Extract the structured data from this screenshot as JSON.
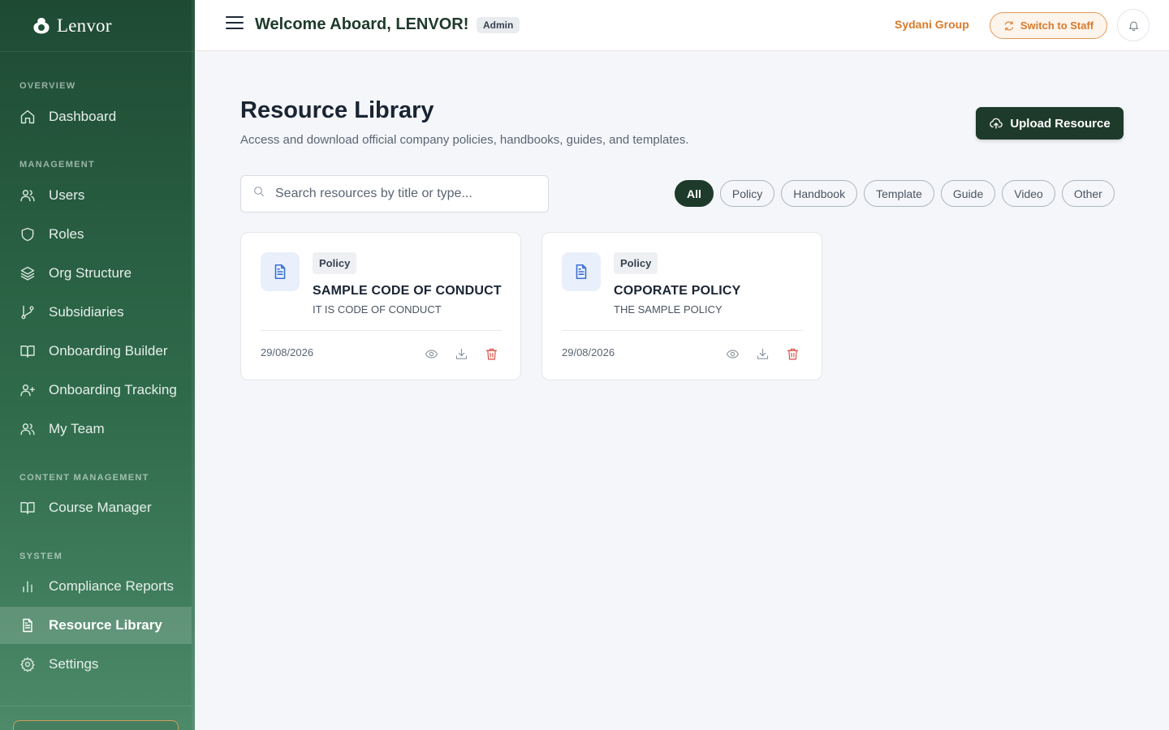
{
  "brand": {
    "name": "Lenvor"
  },
  "sidebar": {
    "sections": [
      {
        "label": "OVERVIEW"
      },
      {
        "label": "MANAGEMENT"
      },
      {
        "label": "CONTENT MANAGEMENT"
      },
      {
        "label": "SYSTEM"
      }
    ],
    "items": [
      {
        "label": "Dashboard",
        "icon": "home-icon"
      },
      {
        "label": "Users",
        "icon": "users-icon"
      },
      {
        "label": "Roles",
        "icon": "shield-icon"
      },
      {
        "label": "Org Structure",
        "icon": "layers-icon"
      },
      {
        "label": "Subsidiaries",
        "icon": "git-branch-icon"
      },
      {
        "label": "Onboarding Builder",
        "icon": "book-icon"
      },
      {
        "label": "Onboarding Tracking",
        "icon": "user-plus-icon"
      },
      {
        "label": "My Team",
        "icon": "users-icon"
      },
      {
        "label": "Course Manager",
        "icon": "book-icon"
      },
      {
        "label": "Compliance Reports",
        "icon": "bar-chart-icon"
      },
      {
        "label": "Resource Library",
        "icon": "file-text-icon",
        "active": true
      },
      {
        "label": "Settings",
        "icon": "gear-icon"
      }
    ]
  },
  "header": {
    "welcome": "Welcome Aboard, LENVOR!",
    "role_badge": "Admin",
    "org_name": "Sydani Group",
    "switch_label": "Switch to Staff"
  },
  "main": {
    "title": "Resource Library",
    "subtitle": "Access and download official company policies, handbooks, guides, and templates.",
    "upload_label": "Upload Resource",
    "search": {
      "placeholder": "Search resources by title or type...",
      "value": ""
    },
    "filters": [
      {
        "label": "All",
        "active": true
      },
      {
        "label": "Policy"
      },
      {
        "label": "Handbook"
      },
      {
        "label": "Template"
      },
      {
        "label": "Guide"
      },
      {
        "label": "Video"
      },
      {
        "label": "Other"
      }
    ],
    "cards": [
      {
        "tag": "Policy",
        "title": "SAMPLE CODE OF CONDUCT",
        "description": "IT IS CODE OF CONDUCT",
        "date": "29/08/2026"
      },
      {
        "tag": "Policy",
        "title": "COPORATE POLICY",
        "description": "THE SAMPLE POLICY",
        "date": "29/08/2026"
      }
    ]
  },
  "colors": {
    "sidebar_dark": "#1e4a33",
    "primary": "#1e3a2b",
    "accent_orange": "#d97a2b",
    "danger": "#d84a3e",
    "file_icon": "#3b6fd1"
  }
}
